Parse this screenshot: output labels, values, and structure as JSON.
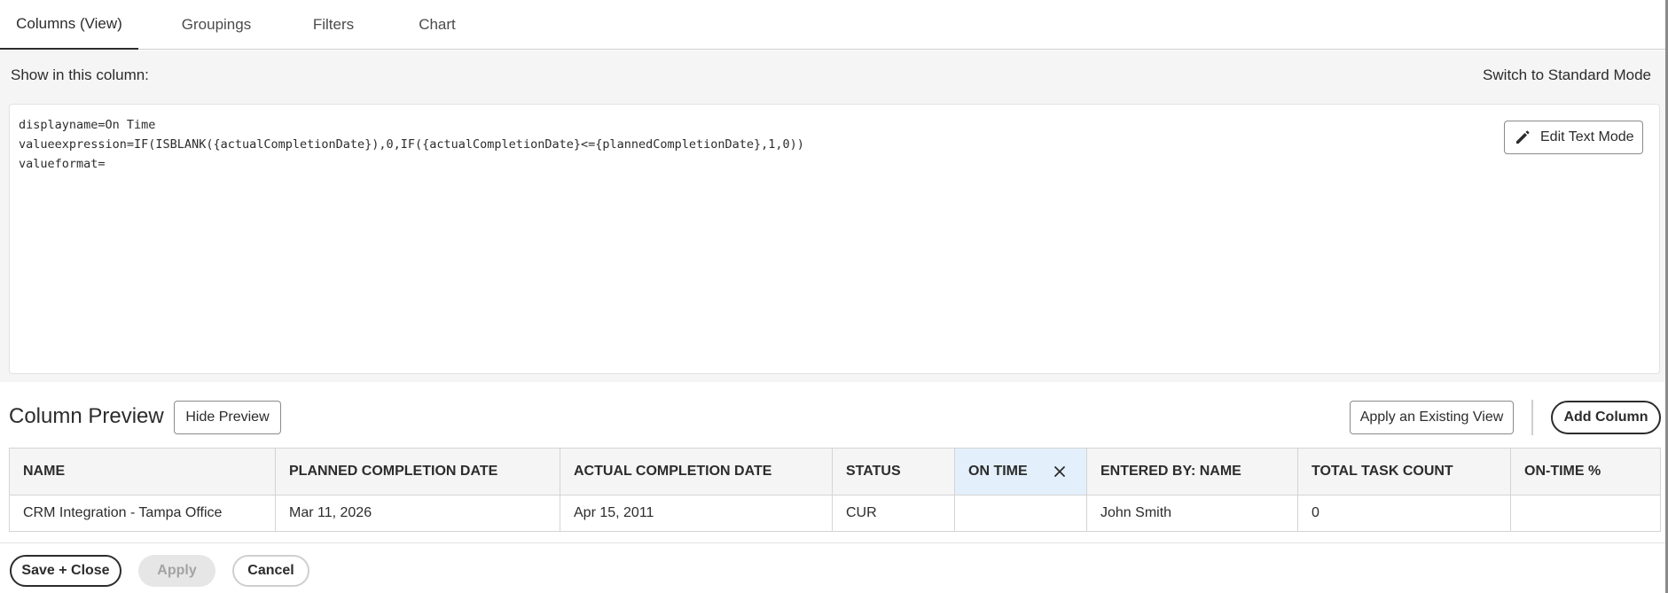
{
  "tabs": [
    {
      "label": "Columns (View)",
      "active": true
    },
    {
      "label": "Groupings",
      "active": false
    },
    {
      "label": "Filters",
      "active": false
    },
    {
      "label": "Chart",
      "active": false
    }
  ],
  "editor": {
    "show_label": "Show in this column:",
    "switch_mode": "Switch to Standard Mode",
    "lines": [
      "displayname=On Time",
      "valueexpression=IF(ISBLANK({actualCompletionDate}),0,IF({actualCompletionDate}<={plannedCompletionDate},1,0))",
      "valueformat="
    ],
    "edit_text_mode": "Edit Text Mode",
    "edit_icon": "pencil-icon"
  },
  "preview": {
    "title": "Column Preview",
    "hide_preview": "Hide Preview",
    "apply_existing_view": "Apply an Existing View",
    "add_column": "Add Column"
  },
  "table": {
    "headers": [
      "NAME",
      "PLANNED COMPLETION DATE",
      "ACTUAL COMPLETION DATE",
      "STATUS",
      "ON TIME",
      "ENTERED BY: NAME",
      "TOTAL TASK COUNT",
      "ON-TIME %"
    ],
    "selected_column": "ON TIME",
    "rows": [
      [
        "CRM Integration - Tampa Office",
        "Mar 11, 2026",
        "Apr 15, 2011",
        "CUR",
        "",
        "John Smith",
        "0",
        ""
      ]
    ]
  },
  "footer": {
    "save_close": "Save + Close",
    "apply": "Apply",
    "cancel": "Cancel"
  },
  "colors": {
    "selected_header": "#e3f0fb",
    "panel_bg": "#f5f5f5",
    "text": "#2c2c2c"
  }
}
